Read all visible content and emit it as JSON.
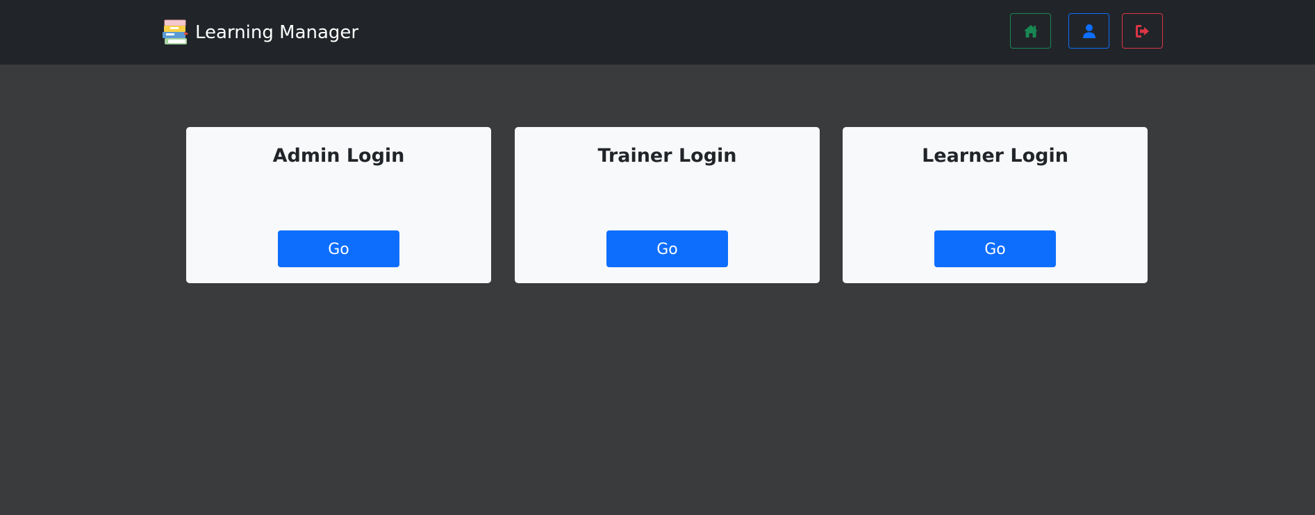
{
  "app": {
    "title": "Learning Manager",
    "logo_icon": "books-stack-icon"
  },
  "navbar": {
    "buttons": [
      {
        "name": "home",
        "icon": "home-icon",
        "color": "#198754"
      },
      {
        "name": "profile",
        "icon": "user-icon",
        "color": "#0d6efd"
      },
      {
        "name": "logout",
        "icon": "logout-icon",
        "color": "#dc3545"
      }
    ]
  },
  "cards": [
    {
      "title": "Admin Login",
      "button_label": "Go"
    },
    {
      "title": "Trainer Login",
      "button_label": "Go"
    },
    {
      "title": "Learner Login",
      "button_label": "Go"
    }
  ],
  "colors": {
    "navbar_bg": "#212529",
    "page_bg": "#3a3b3d",
    "card_bg": "#f8f9fa",
    "primary": "#0d6efd"
  }
}
